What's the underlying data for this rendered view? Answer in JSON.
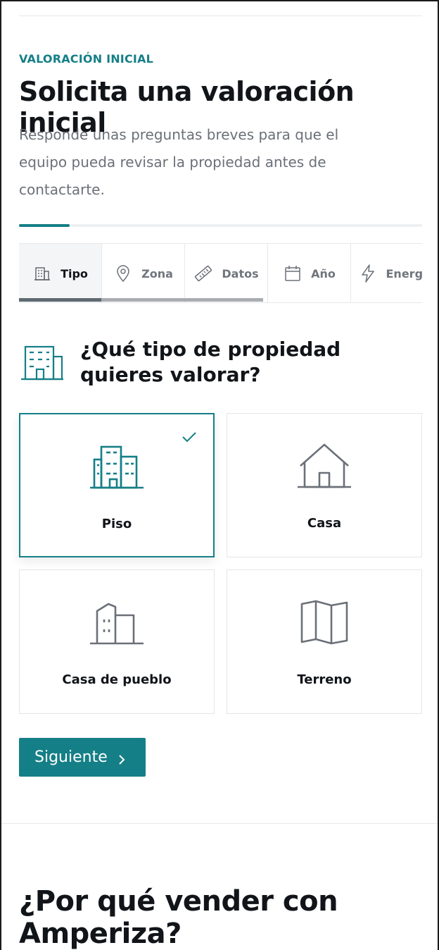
{
  "form": {
    "eyebrow": "VALORACIÓN INICIAL",
    "title": "Solicita una valoración inicial",
    "description": "Responde unas preguntas breves para que el equipo pueda revisar la propiedad antes de contactarte.",
    "progress_fraction": 0.125
  },
  "steps": [
    {
      "label": "Tipo",
      "icon": "building-icon",
      "active": true
    },
    {
      "label": "Zona",
      "icon": "map-pin-icon",
      "active": false
    },
    {
      "label": "Datos",
      "icon": "ruler-icon",
      "active": false
    },
    {
      "label": "Año",
      "icon": "calendar-icon",
      "active": false
    },
    {
      "label": "Energí",
      "icon": "lightning-icon",
      "active": false
    }
  ],
  "question": {
    "text": "¿Qué tipo de propiedad quieres valorar?",
    "icon": "building-icon"
  },
  "options": [
    {
      "label": "Piso",
      "icon": "apartment-building-icon",
      "selected": true
    },
    {
      "label": "Casa",
      "icon": "house-icon",
      "selected": false
    },
    {
      "label": "Casa de pueblo",
      "icon": "town-house-icon",
      "selected": false
    },
    {
      "label": "Terreno",
      "icon": "folded-map-icon",
      "selected": false
    }
  ],
  "actions": {
    "next_label": "Siguiente"
  },
  "next_section": {
    "title": "¿Por qué vender con Amperiza?"
  },
  "colors": {
    "accent": "#157f87",
    "text": "#111418",
    "muted": "#6b7078",
    "border": "#e3e5e8"
  }
}
